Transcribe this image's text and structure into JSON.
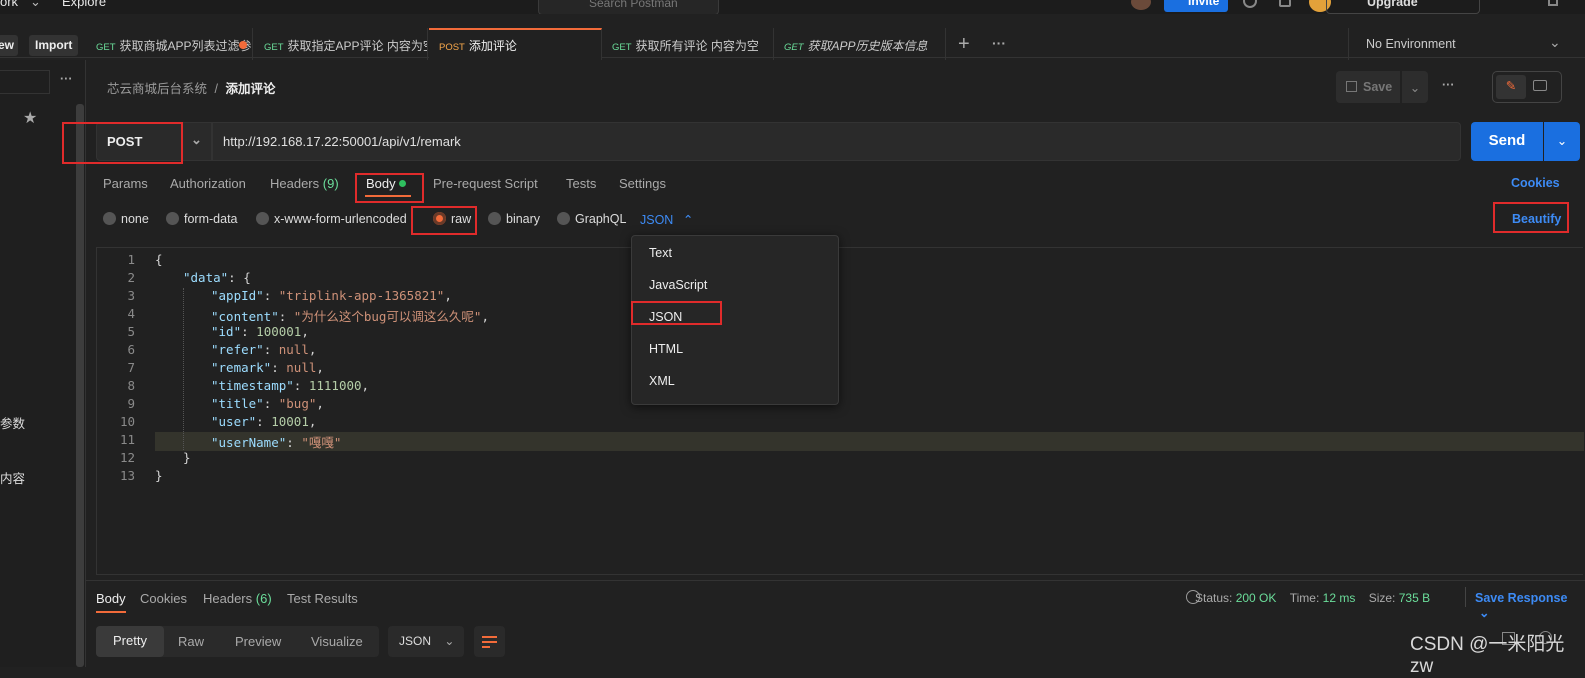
{
  "topbar": {
    "workspace": "ork",
    "explore": "Explore",
    "search_placeholder": "Search Postman",
    "invite": "Invite",
    "upgrade": "Upgrade"
  },
  "sidebar": {
    "new_label": "ew",
    "import_label": "Import",
    "more_icon": "more-icon",
    "cut_text_1": "参数",
    "cut_text_2": "内容"
  },
  "tabs": [
    {
      "method": "GET",
      "label": "获取商城APP列表过滤参",
      "unsaved": true
    },
    {
      "method": "GET",
      "label": "获取指定APP评论 内容为空"
    },
    {
      "method": "POST",
      "label": "添加评论",
      "active": true
    },
    {
      "method": "GET",
      "label": "获取所有评论 内容为空"
    },
    {
      "method": "GET",
      "label": "获取APP历史版本信息"
    }
  ],
  "environment": "No Environment",
  "breadcrumb": {
    "parent": "芯云商城后台系统",
    "separator": "/",
    "current": "添加评论"
  },
  "save_label": "Save",
  "request": {
    "method": "POST",
    "url": "http://192.168.17.22:50001/api/v1/remark",
    "send": "Send"
  },
  "request_tabs": {
    "params": "Params",
    "authorization": "Authorization",
    "headers": "Headers",
    "headers_count": "(9)",
    "body": "Body",
    "prerequest": "Pre-request Script",
    "tests": "Tests",
    "settings": "Settings",
    "cookies": "Cookies"
  },
  "body_types": {
    "none": "none",
    "form_data": "form-data",
    "urlencoded": "x-www-form-urlencoded",
    "raw": "raw",
    "binary": "binary",
    "graphql": "GraphQL",
    "selected": "raw",
    "format": "JSON",
    "beautify": "Beautify"
  },
  "code_lines": [
    "1",
    "2",
    "3",
    "4",
    "5",
    "6",
    "7",
    "8",
    "9",
    "10",
    "11",
    "12",
    "13"
  ],
  "code": {
    "l1": "{",
    "l2_key": "\"data\"",
    "l2_rest": ": {",
    "l3_key": "\"appId\"",
    "l3_val": "\"triplink-app-1365821\"",
    "l4_key": "\"content\"",
    "l4_val": "\"为什么这个bug可以调这么久呢\"",
    "l5_key": "\"id\"",
    "l5_val": "100001",
    "l6_key": "\"refer\"",
    "l6_val": "null",
    "l7_key": "\"remark\"",
    "l7_val": "null",
    "l8_key": "\"timestamp\"",
    "l8_val": "1111000",
    "l9_key": "\"title\"",
    "l9_val": "\"bug\"",
    "l10_key": "\"user\"",
    "l10_val": "10001",
    "l11_key": "\"userName\"",
    "l11_val": "\"嘎嘎\"",
    "l12": "}",
    "l13": "}"
  },
  "format_options": [
    "Text",
    "JavaScript",
    "JSON",
    "HTML",
    "XML"
  ],
  "response": {
    "tabs": {
      "body": "Body",
      "cookies": "Cookies",
      "headers": "Headers",
      "headers_count": "(6)",
      "test_results": "Test Results"
    },
    "status_label": "Status:",
    "status": "200 OK",
    "time_label": "Time:",
    "time": "12 ms",
    "size_label": "Size:",
    "size": "735 B",
    "save_response": "Save Response",
    "views": {
      "pretty": "Pretty",
      "raw": "Raw",
      "preview": "Preview",
      "visualize": "Visualize"
    },
    "format": "JSON"
  },
  "watermark": "CSDN @一米阳光zw",
  "colors": {
    "accent": "#f26b3a",
    "link": "#3d8bf5",
    "send": "#1a6fe0",
    "highlight_box": "#e02b2b",
    "get": "#6bdd9a",
    "post": "#f9a94b"
  }
}
